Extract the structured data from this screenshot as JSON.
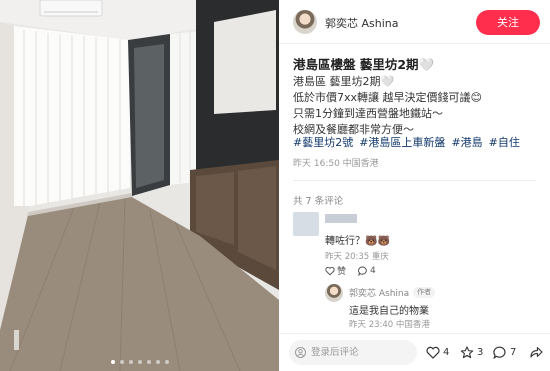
{
  "author": {
    "name": "郭奕芯 Ashina",
    "follow_label": "关注"
  },
  "post": {
    "title": "港島區樓盤 藝里坊2期🤍",
    "body_lines": [
      "港島區 藝里坊2期🤍",
      "低於市價7xx轉讓 越早決定價錢可議😊",
      "只需1分鐘到達西營盤地鐵站～",
      "校網及餐廳都非常方便～"
    ],
    "hashtags": [
      "#藝里坊2號",
      "#港島區上車新盤",
      "#港島",
      "#自住"
    ],
    "meta": "昨天 16:50 中国香港"
  },
  "comments_header": "共 7 条评论",
  "comments": [
    {
      "text": "轉咗行？🐻🐻",
      "meta": "昨天 20:35 重庆",
      "like_label": "赞",
      "reply_count": "4"
    }
  ],
  "reply": {
    "author": "郭奕芯 Ashina",
    "tag": "作者",
    "text": "這是我自己的物業",
    "meta": "昨天 23:40 中国香港"
  },
  "bottom_bar": {
    "comment_placeholder": "登录后评论",
    "likes": "4",
    "stars": "3",
    "comments": "7"
  },
  "carousel": {
    "count": 7,
    "active_index": 0
  },
  "colors": {
    "accent": "#ff2e4d",
    "hashtag": "#13386c"
  }
}
